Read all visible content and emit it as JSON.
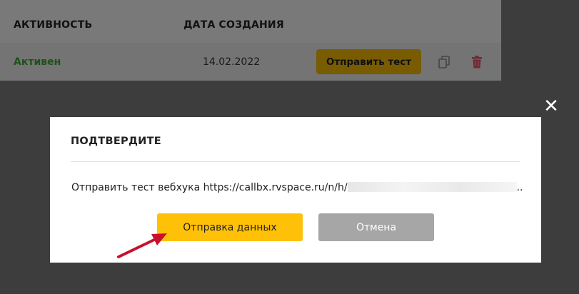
{
  "table": {
    "headers": [
      "АКТИВНОСТЬ",
      "ДАТА СОЗДАНИЯ"
    ],
    "row": {
      "status": "Активен",
      "date": "14.02.2022",
      "send_test_label": "Отправить тест",
      "copy_icon": "copy-icon",
      "delete_icon": "trash-icon"
    }
  },
  "modal": {
    "title": "ПОДТВЕРДИТЕ",
    "message_prefix": "Отправить тест вебхука https://callbx.rvspace.ru/n/h/",
    "message_suffix": "..",
    "confirm_label": "Отправка данных",
    "cancel_label": "Отмена",
    "close_icon": "close-icon"
  },
  "colors": {
    "accent_yellow": "#ffc107",
    "status_green": "#3fa535",
    "cancel_gray": "#a6a6a6",
    "annotation_red": "#c8102e"
  }
}
